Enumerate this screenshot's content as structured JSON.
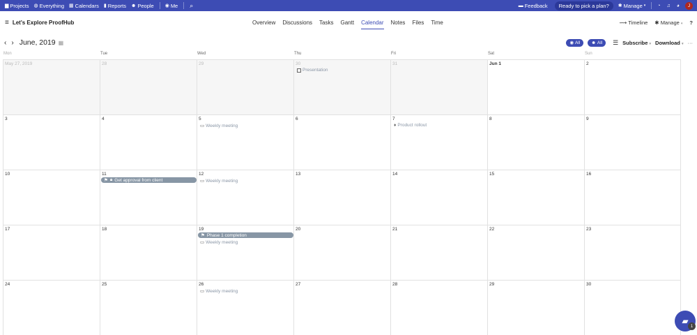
{
  "topnav": {
    "items": [
      {
        "icon": "folder-icon",
        "glyph": "▆",
        "label": "Projects"
      },
      {
        "icon": "globe-icon",
        "glyph": "◍",
        "label": "Everything"
      },
      {
        "icon": "calendar-icon",
        "glyph": "▦",
        "label": "Calendars"
      },
      {
        "icon": "bar-chart-icon",
        "glyph": "▮",
        "label": "Reports"
      },
      {
        "icon": "people-icon",
        "glyph": "☻",
        "label": "People"
      }
    ],
    "me_label": "Me",
    "feedback_label": "Feedback",
    "plan_label": "Ready to pick a plan?",
    "manage_label": "Manage",
    "avatar_initial": "J"
  },
  "project": {
    "title": "Let's Explore ProofHub",
    "tabs": [
      "Overview",
      "Discussions",
      "Tasks",
      "Gantt",
      "Calendar",
      "Notes",
      "Files",
      "Time"
    ],
    "active_tab": "Calendar",
    "timeline_label": "Timeline",
    "manage_label": "Manage"
  },
  "calendar": {
    "month_label": "June, 2019",
    "filter_all_1": "All",
    "filter_all_2": "All",
    "subscribe_label": "Subscribe",
    "download_label": "Download",
    "days_of_week": [
      "Mon",
      "Tue",
      "Wed",
      "Thu",
      "Fri",
      "Sat",
      "Sun"
    ],
    "weeks": [
      [
        {
          "label": "May 27, 2019",
          "outside": true
        },
        {
          "label": "28",
          "outside": true
        },
        {
          "label": "29",
          "outside": true
        },
        {
          "label": "30",
          "outside": true,
          "events": [
            {
              "type": "checkbox",
              "text": "Presentation"
            }
          ]
        },
        {
          "label": "31",
          "outside": true
        },
        {
          "label": "Jun 1",
          "bold": true
        },
        {
          "label": "2"
        }
      ],
      [
        {
          "label": "3"
        },
        {
          "label": "4"
        },
        {
          "label": "5",
          "events": [
            {
              "type": "camera",
              "text": "Weekly meeting"
            }
          ]
        },
        {
          "label": "6"
        },
        {
          "label": "7",
          "events": [
            {
              "type": "bell",
              "text": "Product rollout"
            }
          ]
        },
        {
          "label": "8"
        },
        {
          "label": "9"
        }
      ],
      [
        {
          "label": "10"
        },
        {
          "label": "11",
          "bar": {
            "text": "Get approval from client"
          }
        },
        {
          "label": "12",
          "events": [
            {
              "type": "camera",
              "text": "Weekly meeting"
            }
          ]
        },
        {
          "label": "13"
        },
        {
          "label": "14"
        },
        {
          "label": "15"
        },
        {
          "label": "16"
        }
      ],
      [
        {
          "label": "17"
        },
        {
          "label": "18"
        },
        {
          "label": "19",
          "bar": {
            "text": "Phase 1 completion"
          },
          "events": [
            {
              "type": "camera",
              "text": "Weekly meeting"
            }
          ]
        },
        {
          "label": "20"
        },
        {
          "label": "21"
        },
        {
          "label": "22"
        },
        {
          "label": "23"
        }
      ],
      [
        {
          "label": "24"
        },
        {
          "label": "25"
        },
        {
          "label": "26",
          "events": [
            {
              "type": "camera",
              "text": "Weekly meeting"
            }
          ]
        },
        {
          "label": "27"
        },
        {
          "label": "28"
        },
        {
          "label": "29"
        },
        {
          "label": "30"
        }
      ]
    ]
  },
  "chat": {
    "badge_count": "1"
  }
}
